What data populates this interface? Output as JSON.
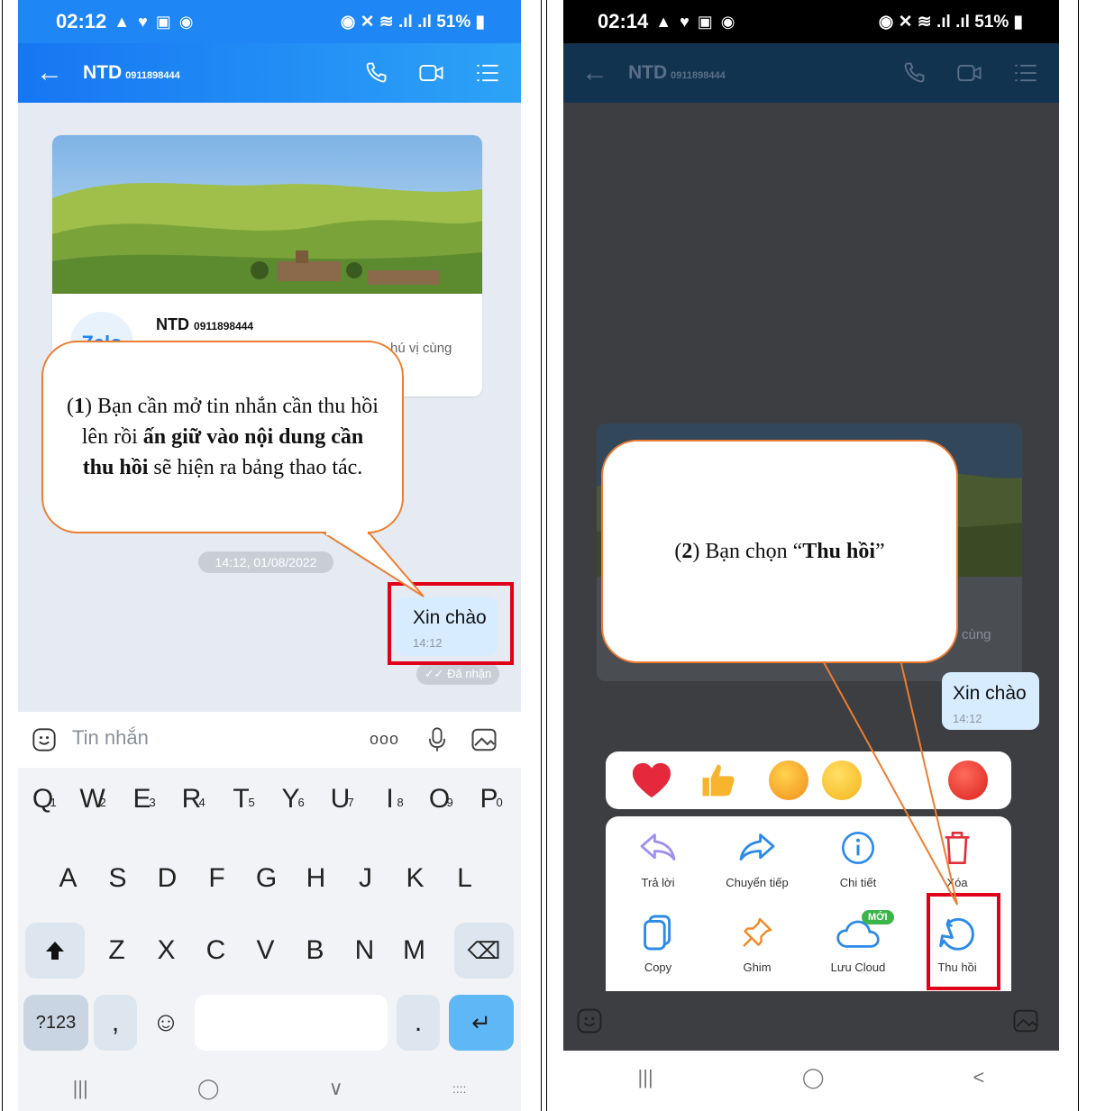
{
  "left": {
    "status": {
      "time": "02:12",
      "icons": "▲ ♥ ▣ ◉",
      "right": "51%"
    },
    "header": {
      "title": "NTD",
      "phone": "0911898444"
    },
    "card": {
      "name": "NTD",
      "phone": "0911898444",
      "logo": "Zalo",
      "snippet": "hú vị cùng"
    },
    "timestamp": "14:12, 01/08/2022",
    "message": {
      "text": "Xin chào",
      "time": "14:12"
    },
    "status_pill": "✓✓ Đã nhận",
    "input_placeholder": "Tin nhắn",
    "more_icon": "ooo",
    "keyboard": {
      "row1": [
        "Q",
        "W",
        "E",
        "R",
        "T",
        "Y",
        "U",
        "I",
        "O",
        "P"
      ],
      "row1_nums": [
        "1",
        "2",
        "3",
        "4",
        "5",
        "6",
        "7",
        "8",
        "9",
        "0"
      ],
      "row2": [
        "A",
        "S",
        "D",
        "F",
        "G",
        "H",
        "J",
        "K",
        "L"
      ],
      "row3": [
        "Z",
        "X",
        "C",
        "V",
        "B",
        "N",
        "M"
      ],
      "sym_key": "?123",
      "comma": ",",
      "emoji": "☺",
      "period": ".",
      "enter": "↵"
    },
    "nav": [
      "|||",
      "◯",
      "∨",
      "::::"
    ],
    "callout": {
      "num": "1",
      "part1": ") Bạn cần mở tin nhắn cần thu hồi lên rồi ",
      "bold": "ấn giữ vào nội dung cần thu hồi",
      "part2": " sẽ hiện ra bảng thao tác."
    }
  },
  "right": {
    "status": {
      "time": "02:14",
      "icons": "▲ ♥ ▣ ◉",
      "right": "51%"
    },
    "header": {
      "title": "NTD",
      "phone": "0911898444"
    },
    "message": {
      "text": "Xin chào",
      "time": "14:12"
    },
    "snippet": "cùng",
    "callout": {
      "num": "2",
      "part1": ") Bạn chọn “",
      "bold": "Thu hồi",
      "part2": "”"
    },
    "menu": [
      {
        "label": "Trả lời",
        "icon": "reply-icon"
      },
      {
        "label": "Chuyển tiếp",
        "icon": "forward-icon"
      },
      {
        "label": "Chi tiết",
        "icon": "info-icon"
      },
      {
        "label": "Xóa",
        "icon": "trash-icon"
      },
      {
        "label": "Copy",
        "icon": "copy-icon"
      },
      {
        "label": "Ghim",
        "icon": "pin-icon"
      },
      {
        "label": "Lưu Cloud",
        "icon": "cloud-icon",
        "badge": "MỚI"
      },
      {
        "label": "Thu hồi",
        "icon": "undo-icon"
      }
    ],
    "nav": [
      "|||",
      "◯",
      "<"
    ]
  },
  "colors": {
    "accent": "#1e86f5",
    "callout_border": "#ed7d31",
    "highlight": "#e0001a"
  }
}
